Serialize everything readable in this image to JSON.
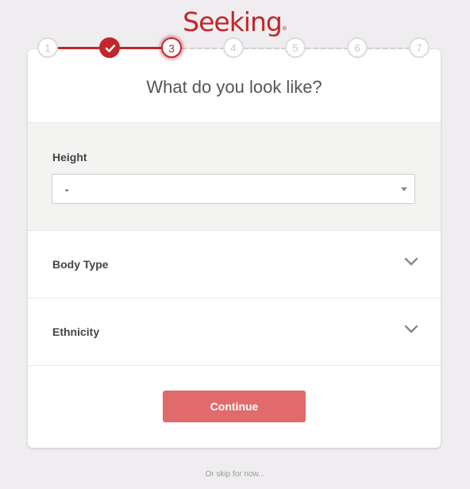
{
  "brand": {
    "logo_text": "Seeking",
    "trademark": "®"
  },
  "steps": [
    {
      "label": "1",
      "state": "inactive"
    },
    {
      "label": "",
      "state": "done",
      "icon": "check-icon"
    },
    {
      "label": "3",
      "state": "current"
    },
    {
      "label": "4",
      "state": "inactive"
    },
    {
      "label": "5",
      "state": "inactive"
    },
    {
      "label": "6",
      "state": "inactive"
    },
    {
      "label": "7",
      "state": "inactive"
    }
  ],
  "card": {
    "title": "What do you look like?",
    "height": {
      "label": "Height",
      "value": "-"
    },
    "body_type": {
      "label": "Body Type"
    },
    "ethnicity": {
      "label": "Ethnicity"
    },
    "continue_label": "Continue"
  },
  "skip_text": "Or skip for now...",
  "colors": {
    "accent": "#c0272d",
    "button": "#e06a6c",
    "background": "#efedef"
  }
}
